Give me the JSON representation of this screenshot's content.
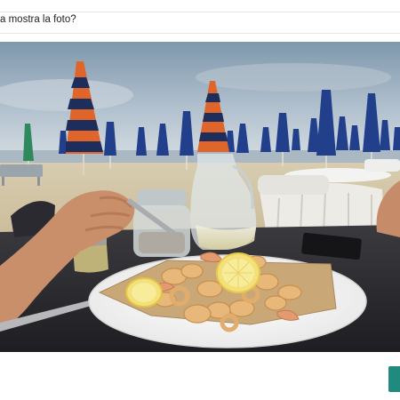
{
  "header": {
    "question_text": "a mostra la foto?"
  },
  "photo": {
    "subject": "beach-restaurant-fried-seafood-photo"
  },
  "colors": {
    "accent_button": "#1f8a7d",
    "sky": "#9fb3c4",
    "table": "#2b2b2e",
    "sand": "#cfc3a6"
  }
}
